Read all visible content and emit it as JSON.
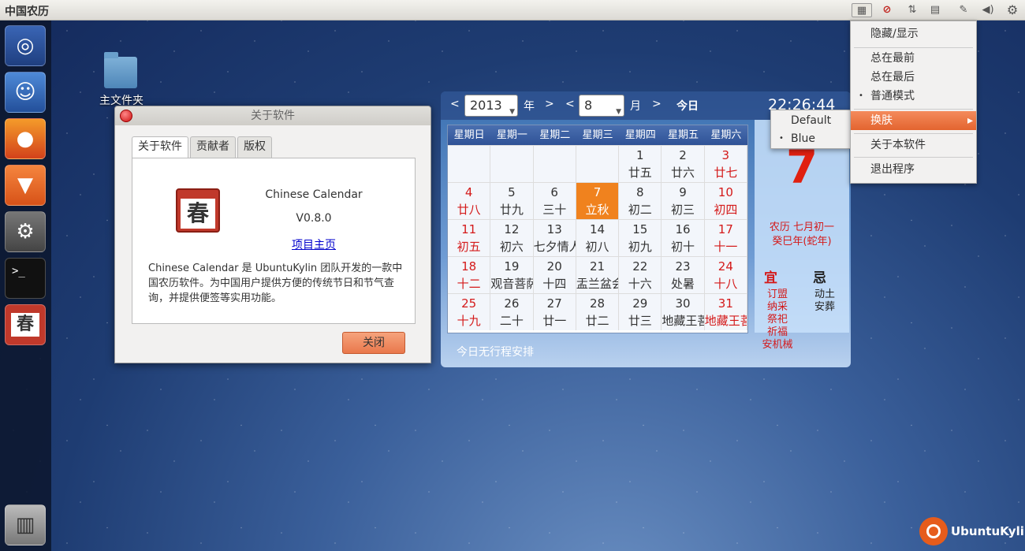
{
  "top_panel": {
    "app_title": "中国农历",
    "indicators": [
      "calendar-indicator-icon",
      "ubuntukylin-icon",
      "network-icon",
      "clipboard-icon",
      "bluetooth-icon",
      "volume-icon",
      "gear-icon"
    ]
  },
  "launcher": {
    "items": [
      "ubuntu-dash-icon",
      "files-icon",
      "firefox-icon",
      "software-center-icon",
      "system-settings-icon",
      "terminal-icon",
      "chinese-calendar-icon",
      "trash-icon"
    ],
    "terminal_glyph": ">_",
    "chun_glyph": "春"
  },
  "desktop": {
    "folder_label": "主文件夹"
  },
  "about_dialog": {
    "title": "关于软件",
    "tabs": [
      "关于软件",
      "贡献者",
      "版权"
    ],
    "icon_text": "春",
    "app_name": "Chinese Calendar",
    "version": "V0.8.0",
    "link": "项目主页",
    "description": "Chinese Calendar 是 UbuntuKylin 团队开发的一款中国农历软件。为中国用户提供方便的传统节日和节气查询，并提供便签等实用功能。",
    "close_button": "关闭"
  },
  "calendar": {
    "prev": "<",
    "next": ">",
    "year": "2013",
    "year_unit": "年",
    "month": "8",
    "month_unit": "月",
    "today_button": "今日",
    "time": "22:26:44",
    "weekdays": [
      "星期日",
      "星期一",
      "星期二",
      "星期三",
      "星期四",
      "星期五",
      "星期六"
    ],
    "weeks": [
      [
        [
          "",
          ""
        ],
        [
          "",
          ""
        ],
        [
          "",
          ""
        ],
        [
          "",
          ""
        ],
        [
          "1",
          "廿五"
        ],
        [
          "2",
          "廿六"
        ],
        [
          "3",
          "廿七"
        ]
      ],
      [
        [
          "4",
          "廿八"
        ],
        [
          "5",
          "廿九"
        ],
        [
          "6",
          "三十"
        ],
        [
          "7",
          "立秋"
        ],
        [
          "8",
          "初二"
        ],
        [
          "9",
          "初三"
        ],
        [
          "10",
          "初四"
        ]
      ],
      [
        [
          "11",
          "初五"
        ],
        [
          "12",
          "初六"
        ],
        [
          "13",
          "七夕情人节"
        ],
        [
          "14",
          "初八"
        ],
        [
          "15",
          "初九"
        ],
        [
          "16",
          "初十"
        ],
        [
          "17",
          "十一"
        ]
      ],
      [
        [
          "18",
          "十二"
        ],
        [
          "19",
          "观音菩萨圣诞 佛"
        ],
        [
          "20",
          "十四"
        ],
        [
          "21",
          "盂兰盆会 普"
        ],
        [
          "22",
          "十六"
        ],
        [
          "23",
          "处暑"
        ],
        [
          "24",
          "十八"
        ]
      ],
      [
        [
          "25",
          "十九"
        ],
        [
          "26",
          "二十"
        ],
        [
          "27",
          "廿一"
        ],
        [
          "28",
          "廿二"
        ],
        [
          "29",
          "廿三"
        ],
        [
          "30",
          "地藏王菩萨圣"
        ],
        [
          "31",
          "地藏王菩萨圣"
        ]
      ]
    ],
    "big_day": "7",
    "lunar_line1": "农历 七月初一",
    "lunar_line2": "癸巳年(蛇年)",
    "yi_label": "宜",
    "ji_label": "忌",
    "yi_items": [
      "订盟",
      "纳采",
      "祭祀",
      "祈福",
      "安机械"
    ],
    "ji_items": [
      "动土",
      "安葬"
    ],
    "footer": "今日无行程安排"
  },
  "menu": {
    "items": [
      "隐藏/显示",
      "总在最前",
      "总在最后",
      "普通模式",
      "换肤",
      "关于本软件",
      "退出程序"
    ],
    "submenu": [
      "Default",
      "Blue"
    ],
    "bullet": "•",
    "arrow": "▸"
  },
  "logo": {
    "text": "UbuntuKylin"
  },
  "colors": {
    "accent": "#e9784c",
    "today": "#f0821e",
    "holiday_red": "#d41a1a"
  }
}
